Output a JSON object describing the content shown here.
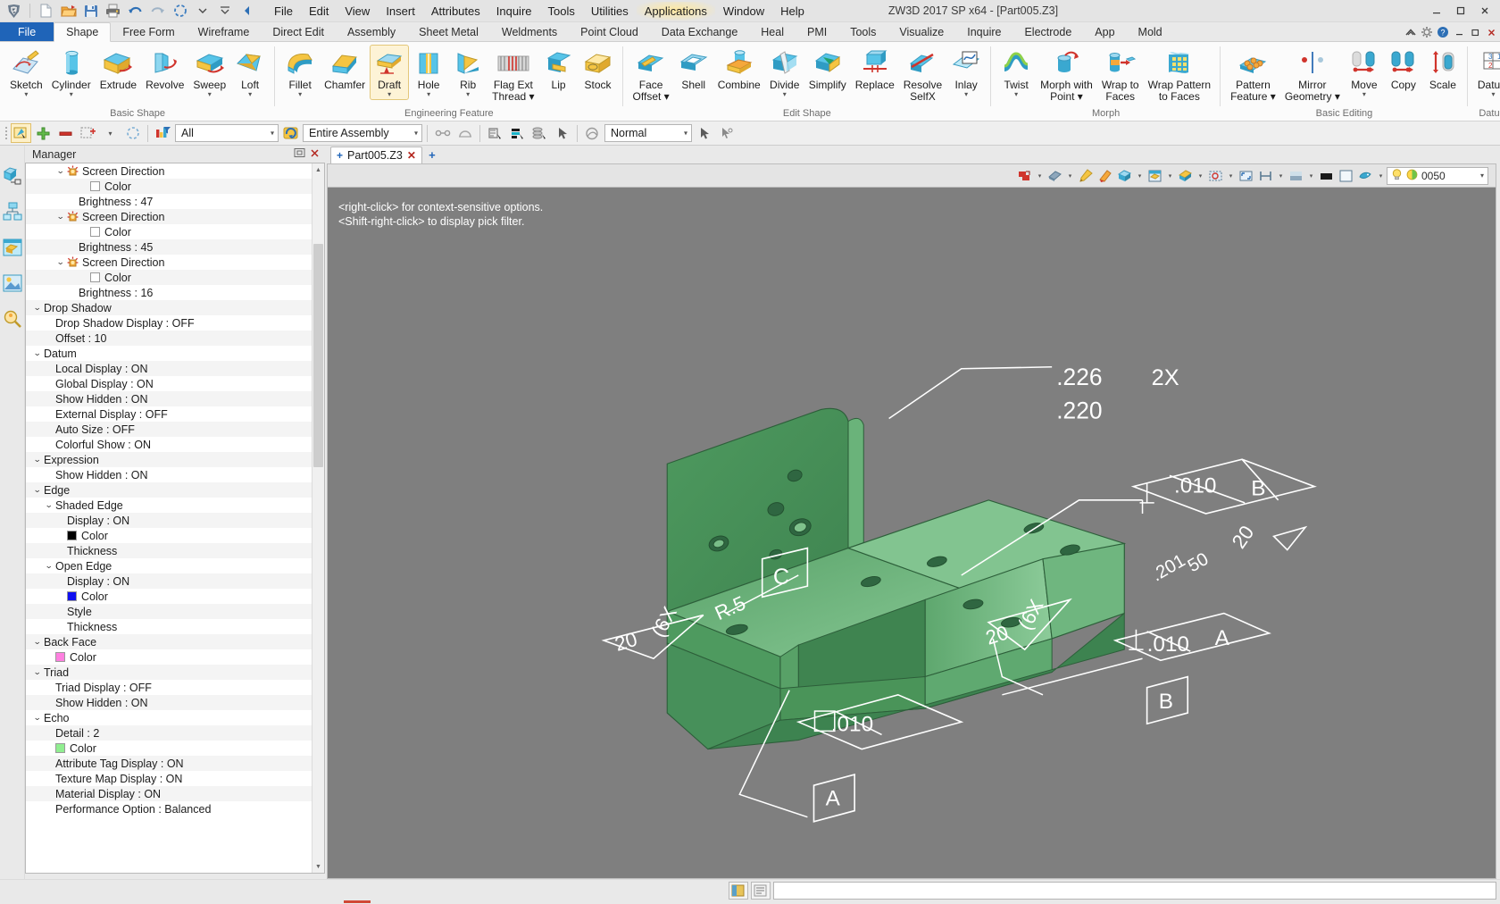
{
  "window": {
    "title": "ZW3D 2017 SP x64 - [Part005.Z3]",
    "minimize": "–",
    "maximize": "❐",
    "close": "✕"
  },
  "menu": {
    "items": [
      {
        "label": "File",
        "highlight": false
      },
      {
        "label": "Edit",
        "highlight": false
      },
      {
        "label": "View",
        "highlight": false
      },
      {
        "label": "Insert",
        "highlight": false
      },
      {
        "label": "Attributes",
        "highlight": false
      },
      {
        "label": "Inquire",
        "highlight": false
      },
      {
        "label": "Tools",
        "highlight": false
      },
      {
        "label": "Utilities",
        "highlight": false
      },
      {
        "label": "Applications",
        "highlight": true
      },
      {
        "label": "Window",
        "highlight": false
      },
      {
        "label": "Help",
        "highlight": false
      }
    ]
  },
  "quick_access": [
    {
      "name": "zw3d-logo-icon"
    },
    {
      "name": "new-file-icon"
    },
    {
      "name": "open-folder-icon"
    },
    {
      "name": "save-icon"
    },
    {
      "name": "print-icon"
    },
    {
      "name": "undo-icon"
    },
    {
      "name": "redo-icon"
    },
    {
      "name": "regen-icon"
    },
    {
      "name": "customize-qat-icon"
    },
    {
      "name": "collapse-ribbon-icon"
    }
  ],
  "ribbon_tabs": [
    {
      "label": "File",
      "kind": "file"
    },
    {
      "label": "Shape",
      "kind": "active"
    },
    {
      "label": "Free Form",
      "kind": "normal"
    },
    {
      "label": "Wireframe",
      "kind": "normal"
    },
    {
      "label": "Direct Edit",
      "kind": "normal"
    },
    {
      "label": "Assembly",
      "kind": "normal"
    },
    {
      "label": "Sheet Metal",
      "kind": "normal"
    },
    {
      "label": "Weldments",
      "kind": "normal"
    },
    {
      "label": "Point Cloud",
      "kind": "normal"
    },
    {
      "label": "Data Exchange",
      "kind": "normal"
    },
    {
      "label": "Heal",
      "kind": "normal"
    },
    {
      "label": "PMI",
      "kind": "normal"
    },
    {
      "label": "Tools",
      "kind": "normal"
    },
    {
      "label": "Visualize",
      "kind": "normal"
    },
    {
      "label": "Inquire",
      "kind": "normal"
    },
    {
      "label": "Electrode",
      "kind": "normal"
    },
    {
      "label": "App",
      "kind": "normal"
    },
    {
      "label": "Mold",
      "kind": "normal"
    }
  ],
  "ribbon_groups": [
    {
      "label": "Basic Shape",
      "buttons": [
        {
          "label": "Sketch",
          "label2": "",
          "icon": "sketch-icon",
          "caret": true,
          "hover": false
        },
        {
          "label": "Cylinder",
          "label2": "",
          "icon": "cylinder-icon",
          "caret": true,
          "hover": false
        },
        {
          "label": "Extrude",
          "label2": "",
          "icon": "extrude-icon",
          "caret": false,
          "hover": false
        },
        {
          "label": "Revolve",
          "label2": "",
          "icon": "revolve-icon",
          "caret": false,
          "hover": false
        },
        {
          "label": "Sweep",
          "label2": "",
          "icon": "sweep-icon",
          "caret": true,
          "hover": false
        },
        {
          "label": "Loft",
          "label2": "",
          "icon": "loft-icon",
          "caret": true,
          "hover": false
        }
      ]
    },
    {
      "label": "Engineering Feature",
      "buttons": [
        {
          "label": "Fillet",
          "label2": "",
          "icon": "fillet-icon",
          "caret": true,
          "hover": false
        },
        {
          "label": "Chamfer",
          "label2": "",
          "icon": "chamfer-icon",
          "caret": false,
          "hover": false
        },
        {
          "label": "Draft",
          "label2": "",
          "icon": "draft-icon",
          "caret": true,
          "hover": true
        },
        {
          "label": "Hole",
          "label2": "",
          "icon": "hole-icon",
          "caret": true,
          "hover": false
        },
        {
          "label": "Rib",
          "label2": "",
          "icon": "rib-icon",
          "caret": true,
          "hover": false
        },
        {
          "label": "Flag Ext",
          "label2": "Thread ▾",
          "icon": "thread-icon",
          "caret": false,
          "hover": false
        },
        {
          "label": "Lip",
          "label2": "",
          "icon": "lip-icon",
          "caret": false,
          "hover": false
        },
        {
          "label": "Stock",
          "label2": "",
          "icon": "stock-icon",
          "caret": false,
          "hover": false
        }
      ]
    },
    {
      "label": "Edit Shape",
      "buttons": [
        {
          "label": "Face",
          "label2": "Offset ▾",
          "icon": "face-offset-icon",
          "caret": false,
          "hover": false
        },
        {
          "label": "Shell",
          "label2": "",
          "icon": "shell-icon",
          "caret": false,
          "hover": false
        },
        {
          "label": "Combine",
          "label2": "",
          "icon": "combine-icon",
          "caret": false,
          "hover": false
        },
        {
          "label": "Divide",
          "label2": "",
          "icon": "divide-icon",
          "caret": true,
          "hover": false
        },
        {
          "label": "Simplify",
          "label2": "",
          "icon": "simplify-icon",
          "caret": false,
          "hover": false
        },
        {
          "label": "Replace",
          "label2": "",
          "icon": "replace-icon",
          "caret": false,
          "hover": false
        },
        {
          "label": "Resolve",
          "label2": "SelfX",
          "icon": "resolve-selfx-icon",
          "caret": false,
          "hover": false
        },
        {
          "label": "Inlay",
          "label2": "",
          "icon": "inlay-icon",
          "caret": true,
          "hover": false
        }
      ]
    },
    {
      "label": "Morph",
      "buttons": [
        {
          "label": "Twist",
          "label2": "",
          "icon": "twist-icon",
          "caret": true,
          "hover": false
        },
        {
          "label": "Morph with",
          "label2": "Point   ▾",
          "icon": "morph-point-icon",
          "caret": false,
          "hover": false
        },
        {
          "label": "Wrap to",
          "label2": "Faces",
          "icon": "wrap-faces-icon",
          "caret": false,
          "hover": false
        },
        {
          "label": "Wrap Pattern",
          "label2": "to Faces",
          "icon": "wrap-pattern-icon",
          "caret": false,
          "hover": false
        }
      ]
    },
    {
      "label": "Basic Editing",
      "buttons": [
        {
          "label": "Pattern",
          "label2": "Feature ▾",
          "icon": "pattern-feature-icon",
          "caret": false,
          "hover": false
        },
        {
          "label": "Mirror",
          "label2": "Geometry ▾",
          "icon": "mirror-geometry-icon",
          "caret": false,
          "hover": false
        },
        {
          "label": "Move",
          "label2": "",
          "icon": "move-icon",
          "caret": true,
          "hover": false
        },
        {
          "label": "Copy",
          "label2": "",
          "icon": "copy-icon",
          "caret": false,
          "hover": false
        },
        {
          "label": "Scale",
          "label2": "",
          "icon": "scale-icon",
          "caret": false,
          "hover": false
        }
      ]
    },
    {
      "label": "Datum",
      "buttons": [
        {
          "label": "Datum",
          "label2": "",
          "icon": "datum-icon",
          "caret": true,
          "hover": false
        }
      ]
    }
  ],
  "toolbar2": {
    "filter_value": "All",
    "scope_value": "Entire Assembly",
    "render_value": "Normal",
    "buttons": [
      {
        "name": "pick-mode-icon",
        "selected": true
      },
      {
        "name": "add-icon",
        "selected": false
      },
      {
        "name": "remove-icon",
        "selected": false
      },
      {
        "name": "select-all-icon",
        "selected": false
      },
      {
        "name": "select-loop-icon",
        "selected": false
      },
      {
        "name": "filter-icon",
        "selected": false
      }
    ],
    "right_buttons": [
      {
        "name": "measure-icon"
      },
      {
        "name": "dimension-icon"
      },
      {
        "name": "face-attr-icon"
      },
      {
        "name": "color-attr-icon"
      },
      {
        "name": "stack-attr-icon"
      },
      {
        "name": "cursor-attr-icon"
      },
      {
        "name": "display-mode-icon"
      },
      {
        "name": "pick-cursor-icon"
      },
      {
        "name": "inquire-point-icon"
      }
    ]
  },
  "left_strip": [
    {
      "name": "history-manager-icon"
    },
    {
      "name": "assembly-manager-icon"
    },
    {
      "name": "shape-manager-icon"
    },
    {
      "name": "visualize-manager-icon"
    },
    {
      "name": "inquire-manager-icon"
    }
  ],
  "manager": {
    "title": "Manager",
    "pin_icon": "restore-panel-icon",
    "close_icon": "close-panel-icon",
    "tree": [
      {
        "indent": 2,
        "chevron": "v",
        "icon": "light-icon",
        "label": "Screen Direction"
      },
      {
        "indent": 4,
        "swatch": "#ffffff",
        "label": "Color"
      },
      {
        "indent": 3,
        "label": "Brightness : 47"
      },
      {
        "indent": 2,
        "chevron": "v",
        "icon": "light-icon",
        "label": "Screen Direction"
      },
      {
        "indent": 4,
        "swatch": "#ffffff",
        "label": "Color"
      },
      {
        "indent": 3,
        "label": "Brightness : 45"
      },
      {
        "indent": 2,
        "chevron": "v",
        "icon": "light-icon",
        "label": "Screen Direction"
      },
      {
        "indent": 4,
        "swatch": "#ffffff",
        "label": "Color"
      },
      {
        "indent": 3,
        "label": "Brightness : 16"
      },
      {
        "indent": 0,
        "chevron": "v",
        "label": "Drop Shadow"
      },
      {
        "indent": 1,
        "label": "Drop Shadow Display : OFF"
      },
      {
        "indent": 1,
        "label": "Offset : 10"
      },
      {
        "indent": 0,
        "chevron": "v",
        "label": "Datum"
      },
      {
        "indent": 1,
        "label": "Local Display : ON"
      },
      {
        "indent": 1,
        "label": "Global Display : ON"
      },
      {
        "indent": 1,
        "label": "Show Hidden : ON"
      },
      {
        "indent": 1,
        "label": "External Display : OFF"
      },
      {
        "indent": 1,
        "label": "Auto Size : OFF"
      },
      {
        "indent": 1,
        "label": "Colorful Show : ON"
      },
      {
        "indent": 0,
        "chevron": "v",
        "label": "Expression"
      },
      {
        "indent": 1,
        "label": "Show Hidden : ON"
      },
      {
        "indent": 0,
        "chevron": "v",
        "label": "Edge"
      },
      {
        "indent": 1,
        "chevron": "v",
        "label": "Shaded Edge"
      },
      {
        "indent": 2,
        "label": "Display : ON"
      },
      {
        "indent": 2,
        "swatch": "#000000",
        "label": "Color"
      },
      {
        "indent": 2,
        "label": "Thickness"
      },
      {
        "indent": 1,
        "chevron": "v",
        "label": "Open Edge"
      },
      {
        "indent": 2,
        "label": "Display : ON"
      },
      {
        "indent": 2,
        "swatch": "#1010f0",
        "label": "Color"
      },
      {
        "indent": 2,
        "label": "Style"
      },
      {
        "indent": 2,
        "label": "Thickness"
      },
      {
        "indent": 0,
        "chevron": "v",
        "label": "Back Face"
      },
      {
        "indent": 1,
        "swatch": "#ff80e0",
        "label": "Color"
      },
      {
        "indent": 0,
        "chevron": "v",
        "label": "Triad"
      },
      {
        "indent": 1,
        "label": "Triad Display : OFF"
      },
      {
        "indent": 1,
        "label": "Show Hidden : ON"
      },
      {
        "indent": 0,
        "chevron": "v",
        "label": "Echo"
      },
      {
        "indent": 1,
        "label": "Detail : 2"
      },
      {
        "indent": 1,
        "swatch": "#90ee90",
        "label": "Color"
      },
      {
        "indent": 1,
        "label": "Attribute Tag Display : ON"
      },
      {
        "indent": 1,
        "label": "Texture Map Display : ON"
      },
      {
        "indent": 1,
        "label": "Material Display : ON"
      },
      {
        "indent": 1,
        "label": "Performance Option : Balanced"
      }
    ]
  },
  "document_tabs": {
    "tabs": [
      {
        "label": "Part005.Z3",
        "plus": "+",
        "close": "✕"
      }
    ],
    "add_tab": "+"
  },
  "viewport_toolbar": {
    "buttons": [
      {
        "name": "redraw-icon",
        "caret": false
      },
      {
        "name": "shade-mode-icon",
        "caret": true
      },
      {
        "name": "paint-face-icon",
        "caret": false
      },
      {
        "name": "highlight-icon",
        "caret": false
      },
      {
        "name": "view-orient-icon",
        "caret": true
      },
      {
        "name": "standard-views-icon",
        "caret": true
      },
      {
        "name": "section-view-icon",
        "caret": true
      },
      {
        "name": "zoom-window-icon",
        "caret": true
      },
      {
        "name": "fit-view-icon",
        "caret": false
      },
      {
        "name": "measure-dist-icon",
        "caret": true
      },
      {
        "name": "background-icon",
        "caret": true
      },
      {
        "name": "black-background-icon",
        "caret": false
      },
      {
        "name": "white-background-icon",
        "caret": false
      },
      {
        "name": "visual-style-icon",
        "caret": true
      }
    ],
    "layer": {
      "bulb_icon": "light-bulb-icon",
      "color_icon": "layer-color-icon",
      "value": "0050"
    }
  },
  "canvas": {
    "hint_line1": "<right-click> for context-sensitive options.",
    "hint_line2": "<Shift-right-click> to display pick filter.",
    "background": "#7f7f7f",
    "model_color": "#4e9a5f",
    "annotations": {
      "dim_226": ".226",
      "dim_220": ".220",
      "qty_2x": "2X",
      "tol_010_b_top": ".010",
      "datum_b_top": "B",
      "tol_010_a": ".010",
      "datum_a_right": "A",
      "datum_b_right": "B",
      "datum_c_left": "C",
      "tol_010_bottom": ".010",
      "datum_a_bottom": "A",
      "rot_20_left": "20",
      "rot_6x_left": "(6X",
      "rot_r5_left": "R.5",
      "rot_20_center": "20",
      "rot_6x_center": "(6X",
      "rot_201_right": ".201",
      "rot_50_right": "50",
      "rot_20_right": "20"
    }
  },
  "statusbar": {
    "buttons": [
      {
        "name": "status-toggle-1-icon"
      },
      {
        "name": "status-toggle-2-icon"
      }
    ],
    "input_value": ""
  }
}
